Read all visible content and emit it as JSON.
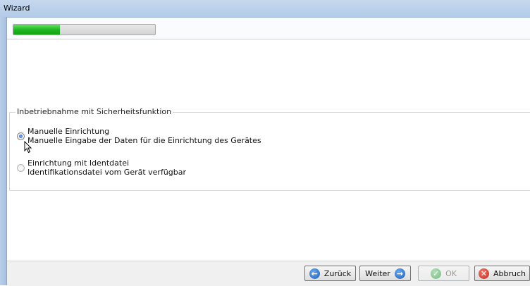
{
  "window": {
    "title": "Wizard"
  },
  "progress": {
    "value_fraction": 0.33
  },
  "group": {
    "legend": "Inbetriebnahme mit Sicherheitsfunktion",
    "options": [
      {
        "title": "Manuelle Einrichtung",
        "description": "Manuelle Eingabe der Daten für die Einrichtung des Gerätes",
        "selected": true
      },
      {
        "title": "Einrichtung mit Identdatei",
        "description": "Identifikationsdatei vom Gerät verfügbar",
        "selected": false
      }
    ]
  },
  "buttons": {
    "back": "Zurück",
    "next": "Weiter",
    "ok": "OK",
    "cancel": "Abbruch"
  },
  "colors": {
    "progress_fill": "#1fb51f",
    "accent": "#1d5fb8",
    "cancel": "#c2281b"
  }
}
